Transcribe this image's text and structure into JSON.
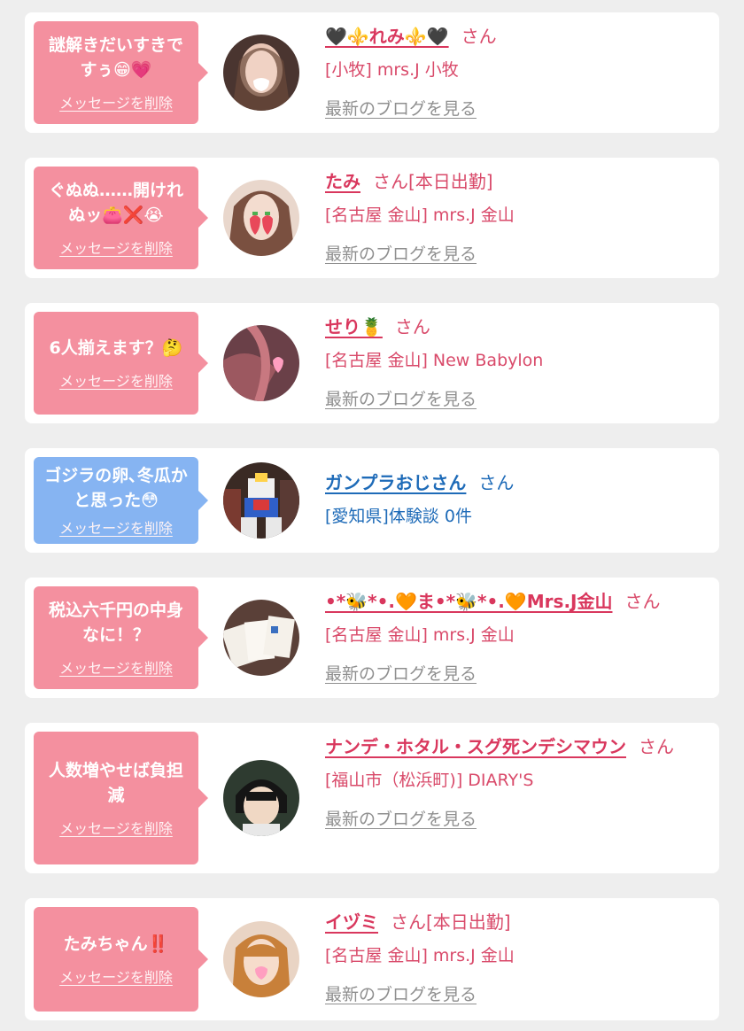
{
  "delete_label": "メッセージを削除",
  "blog_label": "最新のブログを見る",
  "honorific": "さん",
  "cards": [
    {
      "message": "謎解きだいすきですぅ😁💗",
      "name": "🖤⚜️れみ⚜️🖤",
      "status": "",
      "shop": "[小牧] mrs.J 小牧",
      "bubble_color": "pink"
    },
    {
      "message": "ぐぬぬ……開けれぬッ👛❌😭",
      "name": "たみ",
      "status": "[本日出勤]",
      "shop": "[名古屋 金山] mrs.J 金山",
      "bubble_color": "pink"
    },
    {
      "message": "6人揃えます？🤔",
      "name": "せり🍍",
      "status": "",
      "shop": "[名古屋 金山] New Babylon",
      "bubble_color": "pink"
    },
    {
      "message": "ゴジラの卵､冬瓜かと思った😳",
      "name": "ガンプラおじさん",
      "status": "",
      "shop": "[愛知県]体験談 0件",
      "bubble_color": "blue"
    },
    {
      "message": "税込六千円の中身なに！？",
      "name": "•*🐝*•.🧡ま•*🐝*•.🧡Mrs.J金山",
      "status": "",
      "shop": "[名古屋 金山] mrs.J 金山",
      "bubble_color": "pink"
    },
    {
      "message": "人数増やせば負担減",
      "name": "ナンデ・ホタル・スグ死ンデシマウン",
      "status": "",
      "shop": "[福山市（松浜町)] DIARY'S",
      "bubble_color": "pink"
    },
    {
      "message": "たみちゃん‼️",
      "name": "イヅミ",
      "status": "[本日出勤]",
      "shop": "[名古屋 金山] mrs.J 金山",
      "bubble_color": "pink"
    }
  ],
  "colors": {
    "bubble_pink": "#f4909f",
    "bubble_blue": "#86b4f2",
    "name_pink": "#d9375d",
    "name_blue": "#1e6bb8",
    "link_gray": "#8f8f8f"
  }
}
